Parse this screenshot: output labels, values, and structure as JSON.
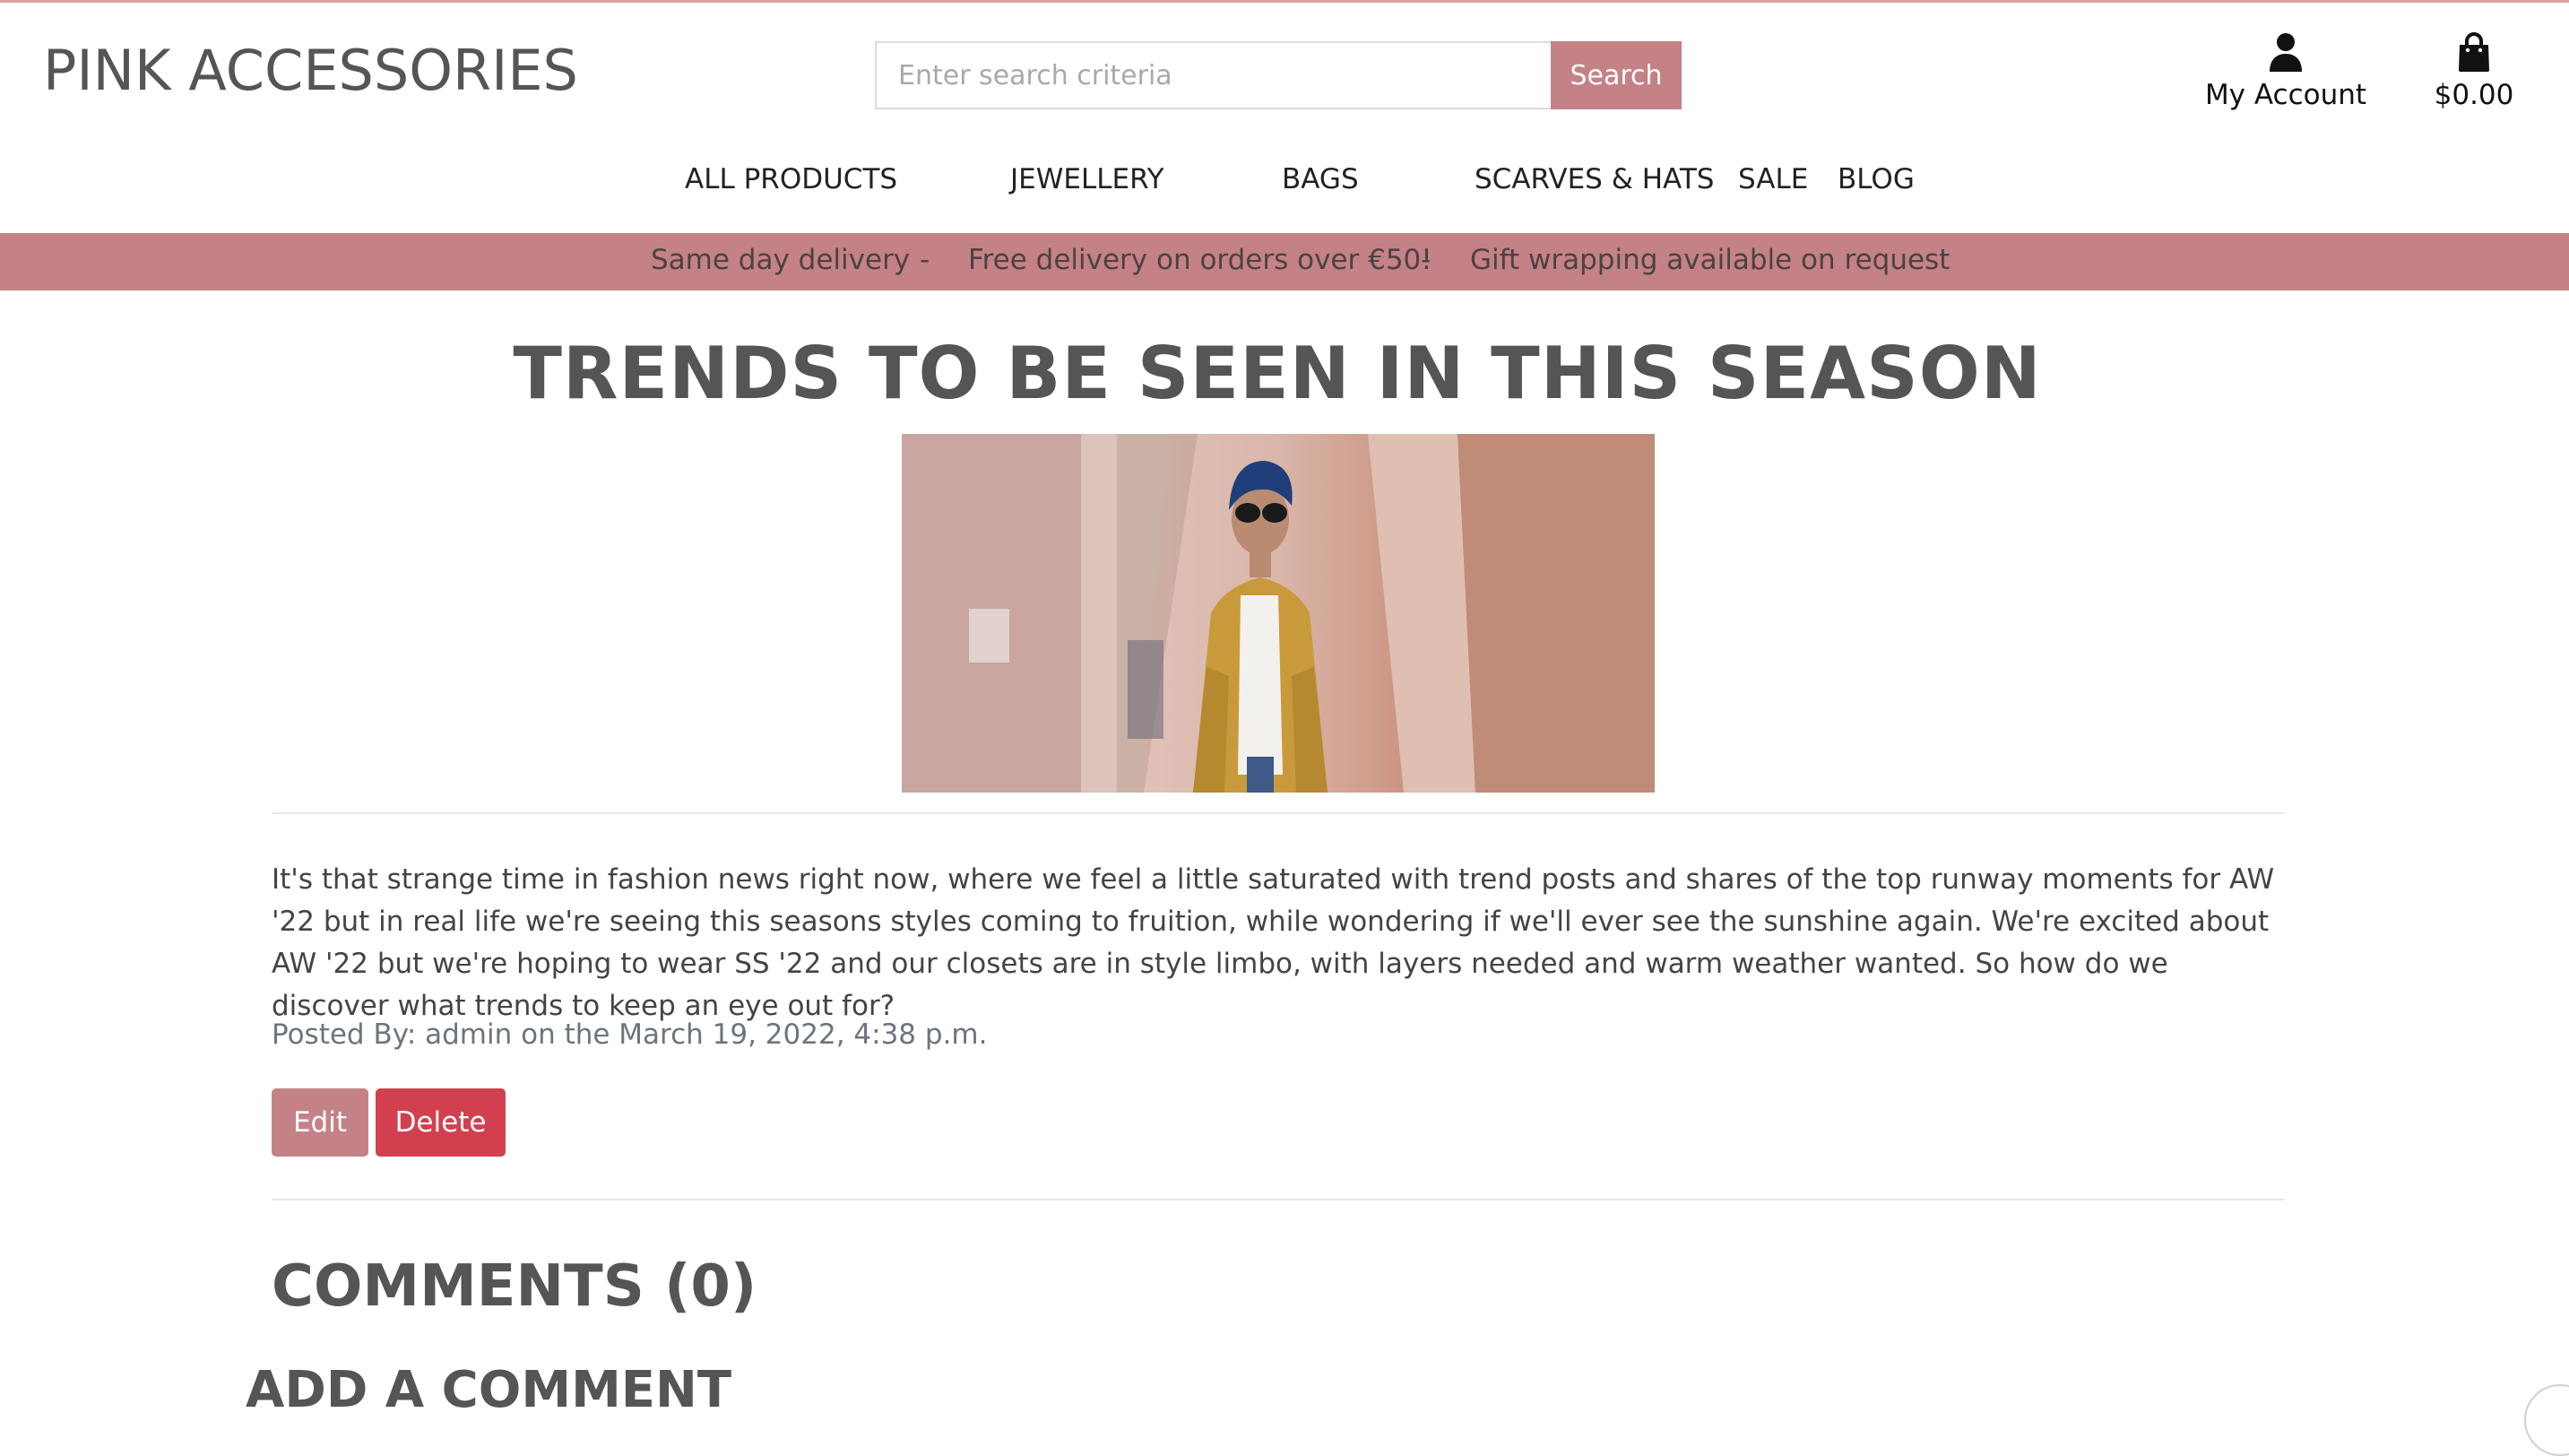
{
  "header": {
    "logo": "PINK ACCESSORIES",
    "search": {
      "placeholder": "Enter search criteria",
      "button_label": "Search"
    },
    "account_label": "My Account",
    "bag_total": "$0.00"
  },
  "nav": {
    "items": [
      {
        "label": "ALL PRODUCTS"
      },
      {
        "label": "JEWELLERY"
      },
      {
        "label": "BAGS"
      },
      {
        "label": "SCARVES & HATS"
      },
      {
        "label": "SALE"
      },
      {
        "label": "BLOG"
      }
    ]
  },
  "promo": {
    "items": [
      "Same day delivery",
      "-",
      "Free delivery on orders over €50!",
      "-",
      "Gift wrapping available on request"
    ]
  },
  "post": {
    "title": "TRENDS TO BE SEEN IN THIS SEASON",
    "image_alt": "",
    "body": "It's that strange time in fashion news right now, where we feel a little saturated with trend posts and shares of the top runway moments for AW '22 but in real life we're seeing this seasons styles coming to fruition, while wondering if we'll ever see the sunshine again. We're excited about AW '22 but we're hoping to wear SS '22 and our closets are in style limbo, with layers needed and warm weather wanted. So how do we discover what trends to keep an eye out for?",
    "meta": "Posted By: admin on the March 19, 2022, 4:38 p.m.",
    "edit_label": "Edit",
    "delete_label": "Delete"
  },
  "comments": {
    "title": "COMMENTS (0)",
    "add_title": "ADD A COMMENT"
  },
  "colors": {
    "brand": "#c48286",
    "danger": "#d2404f",
    "text": "#555555"
  },
  "icons": {
    "account": "user-icon",
    "bag": "shopping-bag-icon"
  }
}
